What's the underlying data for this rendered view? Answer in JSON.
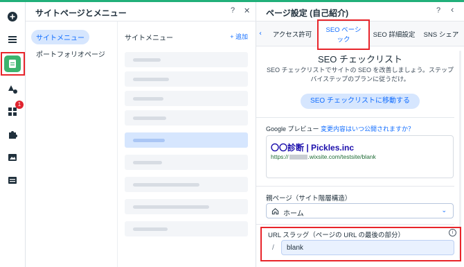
{
  "left_rail": {
    "items": [
      {
        "icon": "plus-circle-icon"
      },
      {
        "icon": "menu-icon"
      },
      {
        "icon": "page-icon"
      },
      {
        "icon": "theme-icon"
      },
      {
        "icon": "apps-icon",
        "badge": "1"
      },
      {
        "icon": "puzzle-icon"
      },
      {
        "icon": "image-icon"
      },
      {
        "icon": "table-icon"
      }
    ]
  },
  "pages_panel": {
    "title": "サイトページとメニュー",
    "help": "?",
    "close": "✕",
    "nav": [
      {
        "label": "サイトメニュー",
        "active": true
      },
      {
        "label": "ポートフォリオページ",
        "active": false
      }
    ],
    "list_title": "サイトメニュー",
    "add_label": "+ 追加"
  },
  "settings_panel": {
    "title": "ページ設定 (自己紹介)",
    "help": "?",
    "back": "‹",
    "tab_prev": "‹",
    "tabs": [
      {
        "label": "アクセス許可"
      },
      {
        "label": "SEO ベーシック",
        "active": true
      },
      {
        "label": "SEO 詳細設定"
      },
      {
        "label": "SNS シェア"
      }
    ],
    "seo": {
      "title": "SEO チェックリスト",
      "description": "SEO チェックリストでサイトの SEO を改善しましょう。ステップバイステップのプランに従うだけ。",
      "button": "SEO チェックリストに移動する"
    },
    "google_preview": {
      "label": "Google プレビュー",
      "link": "変更内容はいつ公開されますか？",
      "title": "〇〇診断 | Pickles.inc",
      "url_prefix": "https://",
      "url_suffix": ".wixsite.com/testsite/blank"
    },
    "parent_page": {
      "label": "親ページ（サイト階層構造）",
      "value": "ホーム"
    },
    "url_slug": {
      "label": "URL スラッグ（ページの URL の最後の部分）",
      "prefix": "/",
      "value": "blank",
      "info": "i"
    }
  },
  "colors": {
    "accent": "#116dff",
    "highlight": "#e8242a",
    "active_rail": "#3cb46e",
    "top_line": "#21b07a"
  }
}
